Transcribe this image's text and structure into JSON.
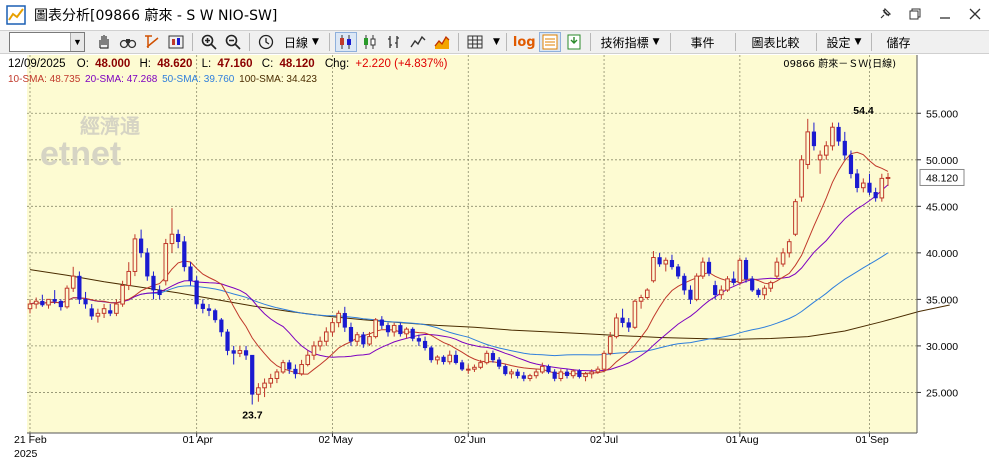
{
  "window": {
    "title": "圖表分析[09866 蔚來 - S W NIO-SW]",
    "buttons": [
      "pin",
      "restore",
      "minimize",
      "close"
    ]
  },
  "toolbar": {
    "symbol_value": "",
    "period_label": "日線",
    "indicators_label": "技術指標",
    "events_label": "事件",
    "compare_label": "圖表比較",
    "settings_label": "設定",
    "save_label": "儲存",
    "log_label": "log"
  },
  "quote": {
    "date": "12/09/2025",
    "open_label": "O:",
    "open": "48.000",
    "high_label": "H:",
    "high": "48.620",
    "low_label": "L:",
    "low": "47.160",
    "close_label": "C:",
    "close": "48.120",
    "chg_label": "Chg:",
    "chg": "+2.220 (+4.837%)",
    "stock_label": "09866  蔚來－ＳＷ(日線)"
  },
  "sma": {
    "sma10": "10-SMA: 48.735",
    "sma20": "20-SMA: 47.268",
    "sma50": "50-SMA: 39.760",
    "sma100": "100-SMA: 34.423"
  },
  "colors": {
    "up": "#c0392b",
    "down": "#1a1ad0",
    "bg": "#fdfbd2",
    "sma10": "#c0392b",
    "sma20": "#7d00c0",
    "sma50": "#2f7fdc",
    "sma100": "#4a2c00",
    "chg": "#e00000"
  },
  "watermark": {
    "top": "經濟通",
    "bottom": "etnet"
  },
  "chart_data": {
    "type": "candlestick",
    "x_labels": [
      "21 Feb",
      "01 Apr",
      "02 May",
      "02 Jun",
      "02 Jul",
      "01 Aug",
      "01 Sep"
    ],
    "year_label": "2025",
    "y_ticks": [
      "25.000",
      "30.000",
      "35.000",
      "40.000",
      "45.000",
      "50.000",
      "55.000"
    ],
    "ylim": [
      21.5,
      57.5
    ],
    "last_price_label": "48.120",
    "annotations": [
      {
        "text": "54.4",
        "index": 135,
        "value": 54.4
      },
      {
        "text": "23.7",
        "index": 36,
        "value": 23.7
      }
    ],
    "candles": [
      {
        "o": 34.0,
        "h": 35.0,
        "l": 33.5,
        "c": 34.5
      },
      {
        "o": 34.5,
        "h": 35.2,
        "l": 34.0,
        "c": 34.8
      },
      {
        "o": 34.8,
        "h": 35.5,
        "l": 34.2,
        "c": 34.4
      },
      {
        "o": 34.4,
        "h": 35.0,
        "l": 34.0,
        "c": 35.0
      },
      {
        "o": 35.0,
        "h": 36.0,
        "l": 34.5,
        "c": 34.8
      },
      {
        "o": 34.8,
        "h": 35.0,
        "l": 33.8,
        "c": 34.2
      },
      {
        "o": 34.2,
        "h": 36.5,
        "l": 34.0,
        "c": 36.2
      },
      {
        "o": 36.2,
        "h": 38.5,
        "l": 35.8,
        "c": 37.5
      },
      {
        "o": 37.5,
        "h": 38.0,
        "l": 34.5,
        "c": 35.0
      },
      {
        "o": 35.0,
        "h": 35.8,
        "l": 34.0,
        "c": 34.5
      },
      {
        "o": 34.0,
        "h": 34.5,
        "l": 32.8,
        "c": 33.2
      },
      {
        "o": 33.2,
        "h": 34.0,
        "l": 32.5,
        "c": 33.5
      },
      {
        "o": 33.5,
        "h": 34.5,
        "l": 33.0,
        "c": 34.0
      },
      {
        "o": 33.8,
        "h": 34.5,
        "l": 33.2,
        "c": 33.5
      },
      {
        "o": 33.5,
        "h": 35.0,
        "l": 33.2,
        "c": 34.5
      },
      {
        "o": 34.5,
        "h": 37.0,
        "l": 34.2,
        "c": 36.5
      },
      {
        "o": 36.5,
        "h": 39.0,
        "l": 36.0,
        "c": 38.0
      },
      {
        "o": 38.0,
        "h": 42.0,
        "l": 37.5,
        "c": 41.5
      },
      {
        "o": 41.5,
        "h": 42.5,
        "l": 39.5,
        "c": 40.0
      },
      {
        "o": 40.0,
        "h": 40.5,
        "l": 37.0,
        "c": 37.5
      },
      {
        "o": 37.5,
        "h": 38.0,
        "l": 35.0,
        "c": 36.0
      },
      {
        "o": 36.0,
        "h": 36.5,
        "l": 35.0,
        "c": 35.5
      },
      {
        "o": 37.0,
        "h": 41.5,
        "l": 36.5,
        "c": 41.0
      },
      {
        "o": 41.0,
        "h": 44.8,
        "l": 40.0,
        "c": 42.0
      },
      {
        "o": 42.0,
        "h": 42.5,
        "l": 40.5,
        "c": 41.2
      },
      {
        "o": 41.2,
        "h": 41.8,
        "l": 38.0,
        "c": 38.5
      },
      {
        "o": 38.5,
        "h": 39.0,
        "l": 36.5,
        "c": 37.0
      },
      {
        "o": 37.0,
        "h": 37.5,
        "l": 34.0,
        "c": 34.5
      },
      {
        "o": 34.5,
        "h": 35.0,
        "l": 33.5,
        "c": 34.0
      },
      {
        "o": 34.0,
        "h": 34.5,
        "l": 33.2,
        "c": 33.8
      },
      {
        "o": 33.8,
        "h": 34.0,
        "l": 32.5,
        "c": 32.8
      },
      {
        "o": 32.8,
        "h": 33.0,
        "l": 31.0,
        "c": 31.5
      },
      {
        "o": 31.5,
        "h": 31.8,
        "l": 29.0,
        "c": 29.5
      },
      {
        "o": 29.5,
        "h": 30.0,
        "l": 28.0,
        "c": 29.2
      },
      {
        "o": 29.2,
        "h": 30.0,
        "l": 28.8,
        "c": 29.5
      },
      {
        "o": 29.5,
        "h": 30.0,
        "l": 28.5,
        "c": 29.0
      },
      {
        "o": 29.0,
        "h": 29.0,
        "l": 23.7,
        "c": 24.8
      },
      {
        "o": 24.8,
        "h": 26.0,
        "l": 24.0,
        "c": 25.5
      },
      {
        "o": 25.5,
        "h": 26.5,
        "l": 24.5,
        "c": 26.0
      },
      {
        "o": 26.0,
        "h": 27.0,
        "l": 25.5,
        "c": 26.5
      },
      {
        "o": 26.5,
        "h": 27.5,
        "l": 26.0,
        "c": 27.2
      },
      {
        "o": 27.2,
        "h": 28.5,
        "l": 27.0,
        "c": 28.2
      },
      {
        "o": 28.2,
        "h": 28.5,
        "l": 27.0,
        "c": 27.5
      },
      {
        "o": 27.5,
        "h": 28.0,
        "l": 26.5,
        "c": 27.0
      },
      {
        "o": 27.0,
        "h": 28.5,
        "l": 26.8,
        "c": 28.0
      },
      {
        "o": 28.0,
        "h": 29.5,
        "l": 27.8,
        "c": 29.0
      },
      {
        "o": 29.0,
        "h": 30.5,
        "l": 28.5,
        "c": 30.0
      },
      {
        "o": 30.0,
        "h": 31.0,
        "l": 29.5,
        "c": 30.5
      },
      {
        "o": 30.5,
        "h": 32.0,
        "l": 30.0,
        "c": 31.5
      },
      {
        "o": 31.5,
        "h": 33.0,
        "l": 31.0,
        "c": 32.5
      },
      {
        "o": 32.5,
        "h": 33.8,
        "l": 32.0,
        "c": 33.5
      },
      {
        "o": 33.5,
        "h": 34.2,
        "l": 31.5,
        "c": 32.0
      },
      {
        "o": 32.0,
        "h": 32.5,
        "l": 30.0,
        "c": 30.5
      },
      {
        "o": 30.5,
        "h": 31.5,
        "l": 30.0,
        "c": 31.2
      },
      {
        "o": 31.2,
        "h": 31.5,
        "l": 29.8,
        "c": 30.2
      },
      {
        "o": 30.2,
        "h": 31.5,
        "l": 30.0,
        "c": 31.0
      },
      {
        "o": 31.0,
        "h": 33.0,
        "l": 30.8,
        "c": 32.8
      },
      {
        "o": 32.8,
        "h": 33.2,
        "l": 31.8,
        "c": 32.2
      },
      {
        "o": 32.2,
        "h": 32.5,
        "l": 31.0,
        "c": 31.5
      },
      {
        "o": 31.5,
        "h": 32.5,
        "l": 31.0,
        "c": 32.2
      },
      {
        "o": 32.2,
        "h": 32.5,
        "l": 31.0,
        "c": 31.3
      },
      {
        "o": 31.3,
        "h": 32.0,
        "l": 30.8,
        "c": 31.8
      },
      {
        "o": 31.8,
        "h": 32.0,
        "l": 30.5,
        "c": 30.8
      },
      {
        "o": 30.8,
        "h": 31.2,
        "l": 30.0,
        "c": 30.5
      },
      {
        "o": 30.5,
        "h": 31.0,
        "l": 29.5,
        "c": 29.8
      },
      {
        "o": 29.8,
        "h": 30.0,
        "l": 28.2,
        "c": 28.5
      },
      {
        "o": 28.5,
        "h": 29.0,
        "l": 28.0,
        "c": 28.8
      },
      {
        "o": 28.8,
        "h": 29.0,
        "l": 28.0,
        "c": 28.3
      },
      {
        "o": 28.3,
        "h": 29.5,
        "l": 28.0,
        "c": 29.0
      },
      {
        "o": 29.0,
        "h": 29.5,
        "l": 28.0,
        "c": 28.2
      },
      {
        "o": 28.2,
        "h": 28.5,
        "l": 27.3,
        "c": 27.5
      },
      {
        "o": 27.5,
        "h": 28.0,
        "l": 27.0,
        "c": 27.5
      },
      {
        "o": 27.5,
        "h": 28.0,
        "l": 27.2,
        "c": 27.7
      },
      {
        "o": 27.7,
        "h": 28.5,
        "l": 27.5,
        "c": 28.2
      },
      {
        "o": 28.2,
        "h": 29.5,
        "l": 28.0,
        "c": 29.2
      },
      {
        "o": 29.2,
        "h": 29.5,
        "l": 28.2,
        "c": 28.5
      },
      {
        "o": 28.5,
        "h": 28.8,
        "l": 27.5,
        "c": 27.8
      },
      {
        "o": 27.8,
        "h": 28.0,
        "l": 26.8,
        "c": 27.0
      },
      {
        "o": 27.0,
        "h": 27.5,
        "l": 26.5,
        "c": 27.2
      },
      {
        "o": 27.2,
        "h": 27.5,
        "l": 26.5,
        "c": 26.8
      },
      {
        "o": 26.8,
        "h": 27.2,
        "l": 26.2,
        "c": 26.5
      },
      {
        "o": 26.5,
        "h": 27.0,
        "l": 26.2,
        "c": 26.8
      },
      {
        "o": 26.8,
        "h": 27.5,
        "l": 26.5,
        "c": 27.2
      },
      {
        "o": 27.2,
        "h": 28.2,
        "l": 27.0,
        "c": 27.8
      },
      {
        "o": 27.8,
        "h": 28.0,
        "l": 27.0,
        "c": 27.2
      },
      {
        "o": 27.2,
        "h": 27.5,
        "l": 26.2,
        "c": 26.5
      },
      {
        "o": 26.5,
        "h": 27.5,
        "l": 26.2,
        "c": 27.2
      },
      {
        "o": 27.2,
        "h": 27.5,
        "l": 26.5,
        "c": 26.8
      },
      {
        "o": 26.8,
        "h": 27.5,
        "l": 26.5,
        "c": 27.3
      },
      {
        "o": 27.3,
        "h": 27.5,
        "l": 26.5,
        "c": 26.7
      },
      {
        "o": 26.7,
        "h": 27.2,
        "l": 26.2,
        "c": 27.0
      },
      {
        "o": 27.0,
        "h": 27.5,
        "l": 26.5,
        "c": 27.2
      },
      {
        "o": 27.2,
        "h": 27.8,
        "l": 27.0,
        "c": 27.5
      },
      {
        "o": 27.5,
        "h": 29.5,
        "l": 27.2,
        "c": 29.2
      },
      {
        "o": 29.2,
        "h": 31.5,
        "l": 29.0,
        "c": 31.0
      },
      {
        "o": 31.0,
        "h": 33.5,
        "l": 30.8,
        "c": 33.0
      },
      {
        "o": 33.0,
        "h": 34.0,
        "l": 32.0,
        "c": 32.5
      },
      {
        "o": 32.5,
        "h": 33.0,
        "l": 31.5,
        "c": 32.0
      },
      {
        "o": 32.0,
        "h": 35.0,
        "l": 31.8,
        "c": 34.8
      },
      {
        "o": 34.8,
        "h": 35.5,
        "l": 34.0,
        "c": 35.2
      },
      {
        "o": 35.2,
        "h": 36.2,
        "l": 35.0,
        "c": 36.0
      },
      {
        "o": 37.0,
        "h": 40.2,
        "l": 36.8,
        "c": 39.5
      },
      {
        "o": 39.5,
        "h": 40.0,
        "l": 38.5,
        "c": 38.8
      },
      {
        "o": 38.8,
        "h": 39.5,
        "l": 38.0,
        "c": 39.2
      },
      {
        "o": 39.2,
        "h": 39.8,
        "l": 38.2,
        "c": 38.5
      },
      {
        "o": 38.5,
        "h": 38.8,
        "l": 37.2,
        "c": 37.5
      },
      {
        "o": 37.5,
        "h": 37.8,
        "l": 35.5,
        "c": 36.0
      },
      {
        "o": 36.0,
        "h": 36.5,
        "l": 34.5,
        "c": 35.0
      },
      {
        "o": 35.0,
        "h": 37.8,
        "l": 34.8,
        "c": 37.5
      },
      {
        "o": 37.5,
        "h": 39.5,
        "l": 37.2,
        "c": 39.0
      },
      {
        "o": 39.0,
        "h": 39.5,
        "l": 37.5,
        "c": 37.8
      },
      {
        "o": 36.5,
        "h": 37.0,
        "l": 35.0,
        "c": 35.5
      },
      {
        "o": 35.5,
        "h": 36.5,
        "l": 35.0,
        "c": 36.0
      },
      {
        "o": 36.0,
        "h": 37.5,
        "l": 35.8,
        "c": 37.2
      },
      {
        "o": 37.2,
        "h": 38.0,
        "l": 36.5,
        "c": 36.8
      },
      {
        "o": 36.8,
        "h": 39.5,
        "l": 36.5,
        "c": 39.2
      },
      {
        "o": 39.2,
        "h": 39.5,
        "l": 36.8,
        "c": 37.2
      },
      {
        "o": 37.2,
        "h": 37.5,
        "l": 35.8,
        "c": 36.0
      },
      {
        "o": 36.0,
        "h": 36.2,
        "l": 35.2,
        "c": 35.5
      },
      {
        "o": 35.5,
        "h": 36.5,
        "l": 35.0,
        "c": 36.2
      },
      {
        "o": 36.2,
        "h": 37.0,
        "l": 35.8,
        "c": 36.8
      },
      {
        "o": 37.5,
        "h": 39.5,
        "l": 37.2,
        "c": 39.0
      },
      {
        "o": 38.8,
        "h": 40.5,
        "l": 38.5,
        "c": 40.0
      },
      {
        "o": 40.0,
        "h": 41.5,
        "l": 39.5,
        "c": 41.2
      },
      {
        "o": 42.0,
        "h": 45.8,
        "l": 41.8,
        "c": 45.5
      },
      {
        "o": 46.0,
        "h": 50.5,
        "l": 45.5,
        "c": 50.0
      },
      {
        "o": 49.5,
        "h": 54.4,
        "l": 49.0,
        "c": 53.0
      },
      {
        "o": 53.0,
        "h": 54.0,
        "l": 51.0,
        "c": 51.5
      },
      {
        "o": 50.0,
        "h": 51.0,
        "l": 48.5,
        "c": 50.5
      },
      {
        "o": 50.5,
        "h": 52.0,
        "l": 50.0,
        "c": 51.5
      },
      {
        "o": 51.5,
        "h": 54.0,
        "l": 51.0,
        "c": 53.5
      },
      {
        "o": 53.5,
        "h": 54.0,
        "l": 51.5,
        "c": 52.0
      },
      {
        "o": 52.0,
        "h": 53.0,
        "l": 50.0,
        "c": 50.5
      },
      {
        "o": 50.5,
        "h": 51.0,
        "l": 48.0,
        "c": 48.5
      },
      {
        "o": 48.5,
        "h": 49.0,
        "l": 46.5,
        "c": 47.0
      },
      {
        "o": 47.0,
        "h": 48.0,
        "l": 46.5,
        "c": 47.5
      },
      {
        "o": 47.5,
        "h": 48.5,
        "l": 46.2,
        "c": 46.5
      },
      {
        "o": 46.5,
        "h": 47.0,
        "l": 45.5,
        "c": 45.9
      },
      {
        "o": 45.9,
        "h": 48.5,
        "l": 45.5,
        "c": 48.0
      },
      {
        "o": 48.0,
        "h": 48.6,
        "l": 47.2,
        "c": 48.1
      }
    ],
    "sma100": [
      [
        0,
        38.2
      ],
      [
        6,
        37.6
      ],
      [
        12,
        36.9
      ],
      [
        18,
        36.3
      ],
      [
        24,
        35.7
      ],
      [
        30,
        35.0
      ],
      [
        36,
        34.3
      ],
      [
        42,
        33.7
      ],
      [
        48,
        33.2
      ],
      [
        54,
        32.8
      ],
      [
        60,
        32.5
      ],
      [
        66,
        32.2
      ],
      [
        72,
        32.0
      ],
      [
        78,
        31.7
      ],
      [
        84,
        31.5
      ],
      [
        90,
        31.3
      ],
      [
        96,
        31.1
      ],
      [
        102,
        30.9
      ],
      [
        108,
        30.8
      ],
      [
        114,
        30.7
      ],
      [
        120,
        30.8
      ],
      [
        126,
        31.0
      ],
      [
        132,
        31.6
      ],
      [
        138,
        32.6
      ],
      [
        144,
        33.7
      ],
      [
        149,
        34.4
      ]
    ]
  }
}
